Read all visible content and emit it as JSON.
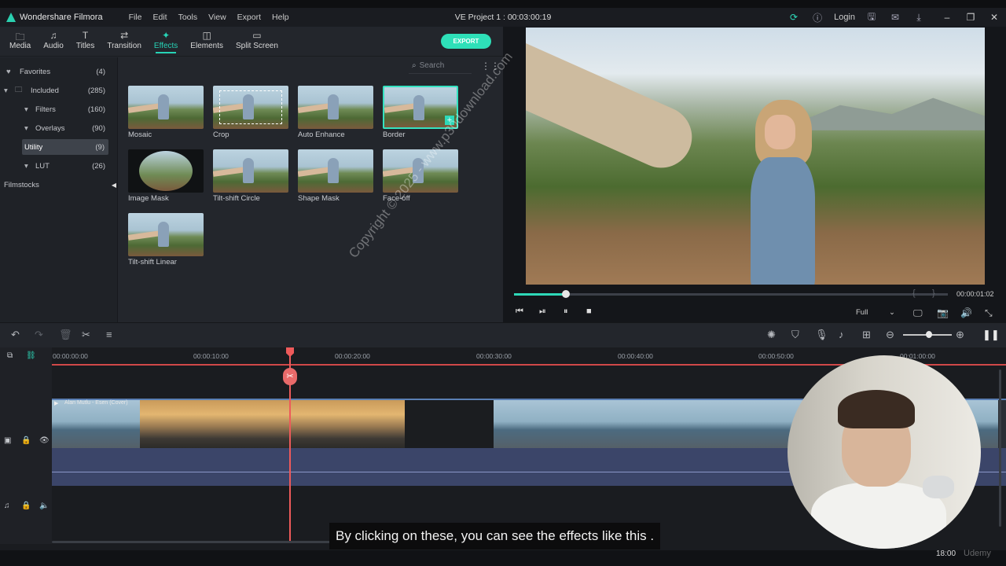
{
  "app": {
    "name": "Wondershare Filmora",
    "project_title": "VE Project 1 : 00:03:00:19",
    "menu": [
      "File",
      "Edit",
      "Tools",
      "View",
      "Export",
      "Help"
    ],
    "login_label": "Login"
  },
  "tabs": [
    {
      "label": "Media",
      "icon": "folder-icon",
      "glyph": "🗀"
    },
    {
      "label": "Audio",
      "icon": "music-note-icon",
      "glyph": "♫"
    },
    {
      "label": "Titles",
      "icon": "text-icon",
      "glyph": "T"
    },
    {
      "label": "Transition",
      "icon": "transition-icon",
      "glyph": "⇄"
    },
    {
      "label": "Effects",
      "icon": "effects-icon",
      "glyph": "✦",
      "active": true
    },
    {
      "label": "Elements",
      "icon": "elements-icon",
      "glyph": "◫"
    },
    {
      "label": "Split Screen",
      "icon": "split-screen-icon",
      "glyph": "▭"
    }
  ],
  "export_label": "EXPORT",
  "sidebar": [
    {
      "label": "Favorites",
      "count": "(4)",
      "icon": "heart-icon",
      "glyph": "♥",
      "arrow": ""
    },
    {
      "label": "Included",
      "count": "(285)",
      "icon": "folder-icon",
      "glyph": "🗀",
      "arrow": "▾"
    },
    {
      "label": "Filters",
      "count": "(160)",
      "icon": "",
      "glyph": "",
      "arrow": "▾"
    },
    {
      "label": "Overlays",
      "count": "(90)",
      "icon": "",
      "glyph": "",
      "arrow": "▾"
    },
    {
      "label": "Utility",
      "count": "(9)",
      "icon": "",
      "glyph": "",
      "arrow": "",
      "selected": true
    },
    {
      "label": "LUT",
      "count": "(26)",
      "icon": "",
      "glyph": "",
      "arrow": "▾"
    },
    {
      "label": "Filmstocks",
      "count": "",
      "icon": "",
      "glyph": "",
      "arrow": ""
    }
  ],
  "search_placeholder": "Search",
  "effects": [
    {
      "label": "Mosaic"
    },
    {
      "label": "Crop"
    },
    {
      "label": "Auto Enhance"
    },
    {
      "label": "Border",
      "selected": true
    },
    {
      "label": "Image Mask"
    },
    {
      "label": "Tilt-shift Circle"
    },
    {
      "label": "Shape Mask"
    },
    {
      "label": "Face-off"
    },
    {
      "label": "Tilt-shift Linear"
    }
  ],
  "preview": {
    "time": "00:00:01:02",
    "progress": 0.12,
    "quality": "Full",
    "brace_left": "{",
    "brace_right": "}"
  },
  "ruler": [
    "00:00:00:00",
    "00:00:10:00",
    "00:00:20:00",
    "00:00:30:00",
    "00:00:40:00",
    "00:00:50:00",
    "00:01:00:00"
  ],
  "clip_name": "Alan Mutlu - Esen (Cover)",
  "caption": "By clicking on these, you can see the effects like this .",
  "watermark": "Copyright © 2025 - www.p30download.com",
  "taskbar_time": "18:00",
  "udemy": "Udemy",
  "colors": {
    "accent": "#27d3b6",
    "playhead": "#ee5a5a",
    "audio_clip": "#3b4569"
  }
}
